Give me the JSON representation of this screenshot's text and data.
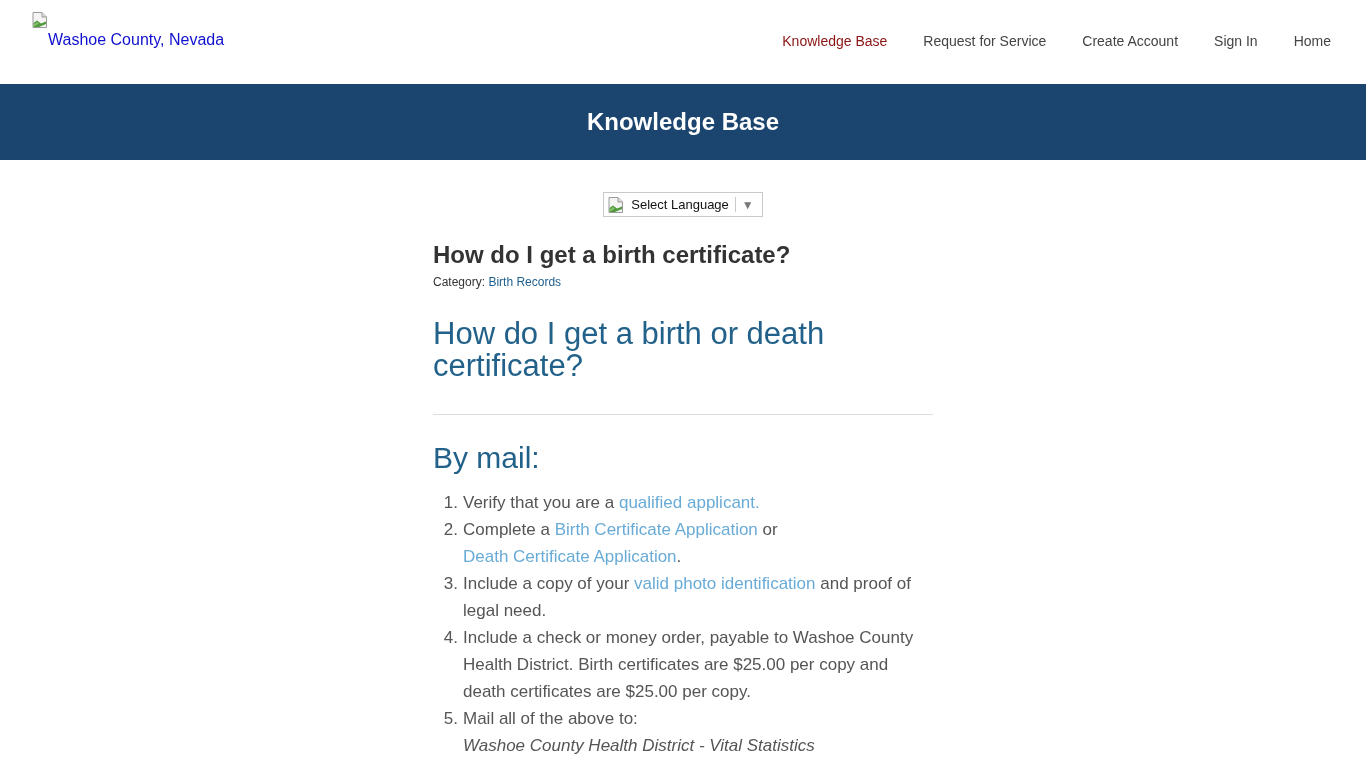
{
  "header": {
    "logo_text": "Washoe County, Nevada"
  },
  "nav": [
    {
      "label": "Knowledge Base",
      "selected": true
    },
    {
      "label": "Request for Service",
      "selected": false
    },
    {
      "label": "Create Account",
      "selected": false
    },
    {
      "label": "Sign In",
      "selected": false
    },
    {
      "label": "Home",
      "selected": false
    }
  ],
  "banner": {
    "title": "Knowledge Base"
  },
  "language_select": {
    "value": "Select Language",
    "arrow": "▼"
  },
  "article": {
    "title": "How do I get a birth certificate?",
    "category_label": "Category:",
    "category": "Birth Records",
    "heading": "How do I get a birth or death certificate?",
    "section_heading": "By mail:",
    "steps": [
      {
        "number": "1.",
        "segments": [
          {
            "kind": "text",
            "text": "Verify that you are a "
          },
          {
            "kind": "link",
            "text": "qualified applicant."
          }
        ]
      },
      {
        "number": "2.",
        "segments": [
          {
            "kind": "text",
            "text": "Complete a "
          },
          {
            "kind": "link",
            "text": "Birth Certificate Application"
          },
          {
            "kind": "text",
            "text": " or "
          },
          {
            "kind": "link",
            "text": "Death Certificate Application"
          },
          {
            "kind": "text",
            "text": "."
          }
        ]
      },
      {
        "number": "3.",
        "segments": [
          {
            "kind": "text",
            "text": "Include a copy of your "
          },
          {
            "kind": "link",
            "text": "valid photo identification"
          },
          {
            "kind": "text",
            "text": " and proof of legal need."
          }
        ]
      },
      {
        "number": "4.",
        "segments": [
          {
            "kind": "text",
            "text": "Include a check or money order, payable to Washoe County Health District. Birth certificates are $25.00 per copy and death certificates are $25.00 per copy."
          }
        ]
      },
      {
        "number": "5.",
        "segments": [
          {
            "kind": "text",
            "text": "Mail all of the above to:"
          }
        ],
        "address_lines": [
          "Washoe County Health District - Vital Statistics"
        ]
      }
    ]
  }
}
